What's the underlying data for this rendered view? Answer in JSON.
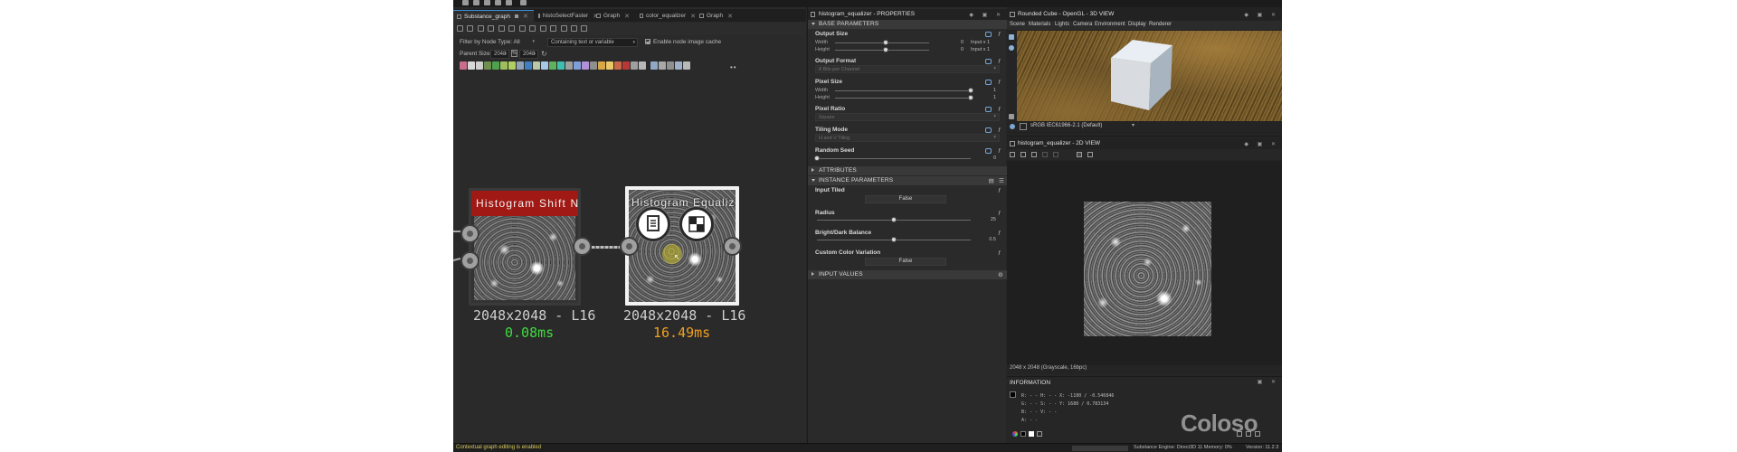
{
  "graph": {
    "tabs": [
      {
        "label": "Substance_graph",
        "active": true
      },
      {
        "label": "histoSelectFaster",
        "active": false
      },
      {
        "label": "Graph",
        "active": false
      },
      {
        "label": "color_equalizer",
        "active": false
      },
      {
        "label": "Graph",
        "active": false
      }
    ],
    "filter": {
      "by_type_label": "Filter by Node Type:",
      "by_type_value": "All",
      "containing_placeholder": "Containing text or variable",
      "cache_label": "Enable node image cache",
      "cache_checked": true
    },
    "parent_size": {
      "label": "Parent Size:",
      "width": "2048",
      "height": "2048"
    },
    "nodes": [
      {
        "title": "Histogram Shift No…",
        "size": "2048x2048 - L16",
        "time": "0.08ms",
        "time_color": "#3fdc3f"
      },
      {
        "title": "Histogram Equalizer",
        "size": "2048x2048 - L16",
        "time": "16.49ms",
        "time_color": "#f0a020"
      }
    ]
  },
  "properties": {
    "title": "histogram_equalizer - PROPERTIES",
    "sections": {
      "base": "BASE PARAMETERS",
      "attributes": "ATTRIBUTES",
      "instance": "INSTANCE PARAMETERS",
      "inputs": "INPUT VALUES"
    },
    "output_size": {
      "label": "Output Size",
      "width_label": "Width",
      "height_label": "Height",
      "width_value": "0",
      "height_value": "0",
      "width_unit": "Input x 1",
      "height_unit": "Input x 1"
    },
    "output_format": {
      "label": "Output Format",
      "value": "8 Bits per Channel"
    },
    "pixel_size": {
      "label": "Pixel Size",
      "width_label": "Width",
      "height_label": "Height",
      "width_value": "1",
      "height_value": "1"
    },
    "pixel_ratio": {
      "label": "Pixel Ratio",
      "value": "Square"
    },
    "tiling_mode": {
      "label": "Tiling Mode",
      "value": "H and V Tiling"
    },
    "random_seed": {
      "label": "Random Seed",
      "value": "0"
    },
    "input_tiled": {
      "label": "Input Tiled",
      "value": "False"
    },
    "radius": {
      "label": "Radius",
      "value": "25",
      "fraction": 0.5
    },
    "bright_dark": {
      "label": "Bright/Dark Balance",
      "value": "0.5",
      "fraction": 0.5
    },
    "custom_color": {
      "label": "Custom Color Variation",
      "value": "False"
    }
  },
  "view3d": {
    "title": "Rounded Cube - OpenGL - 3D VIEW",
    "menu": [
      "Scene",
      "Materials",
      "Lights",
      "Camera",
      "Environment",
      "Display",
      "Renderer"
    ],
    "colorspace": "sRGB IEC61966-2.1 (Default)"
  },
  "view2d": {
    "title": "histogram_equalizer - 2D VIEW",
    "info": "2048 x 2048 (Grayscale, 16bpc)"
  },
  "information": {
    "title": "INFORMATION",
    "rows": [
      "R: - -      H: - -      X: -1180 / -0.546846",
      "G: - -      S: - -      Y:  1680 / 0.783134",
      "B: - -      V: - -",
      "A: - -"
    ],
    "logo": "Coloso"
  },
  "status": {
    "message": "Contextual graph editing is enabled",
    "engine": "Substance Engine: Direct3D 11  Memory: 0%",
    "version": "Version: 11.2.3"
  },
  "colors": {
    "accent": "#3d8fd8",
    "node_header": "#a11914"
  }
}
